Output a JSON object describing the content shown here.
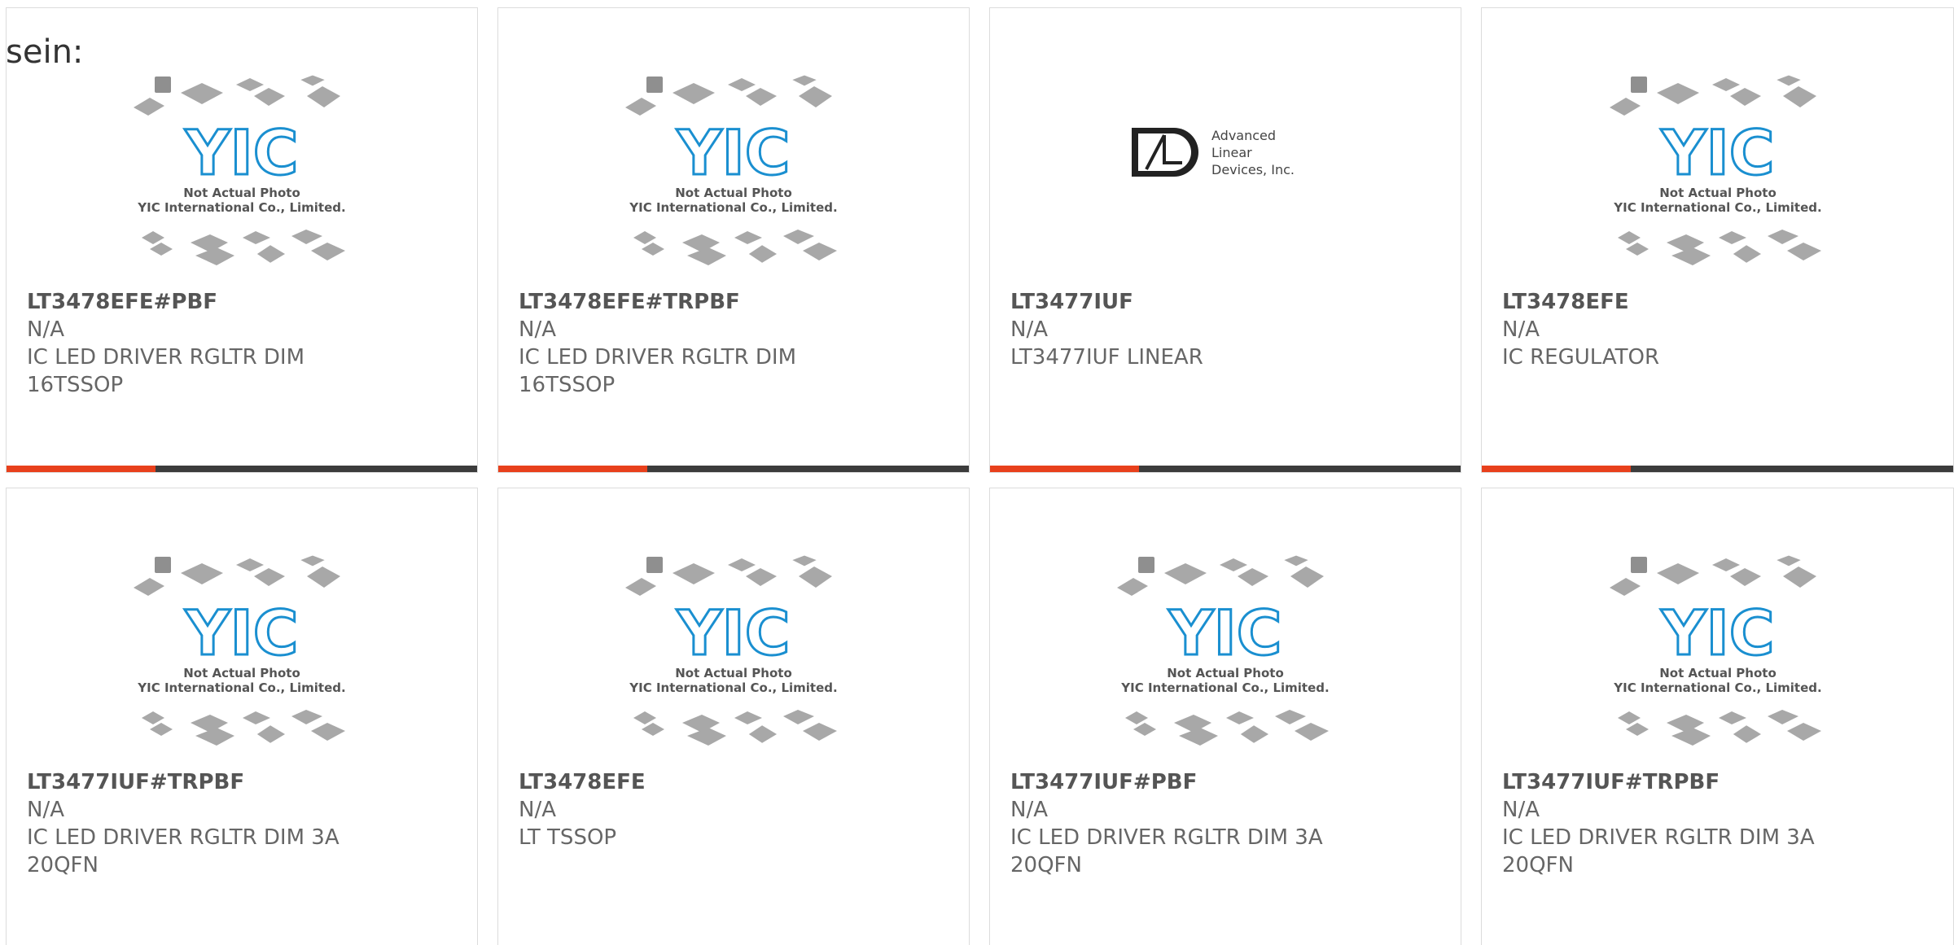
{
  "heading": "sein:",
  "placeholder_image": {
    "brand": "YIC",
    "caption_line1": "Not Actual Photo",
    "caption_line2": "YIC International Co., Limited.",
    "icon": "chip-packages-placeholder"
  },
  "ald_logo": {
    "line1": "Advanced",
    "line2": "Linear",
    "line3": "Devices, Inc.",
    "icon": "ald-logo"
  },
  "colors": {
    "accent": "#e8401c",
    "bar": "#3c3c3c",
    "yic_blue": "#1a8fd0"
  },
  "products": [
    {
      "part": "LT3478EFE#PBF",
      "mfr": "N/A",
      "desc": "IC LED DRIVER RGLTR DIM 16TSSOP",
      "image": "placeholder"
    },
    {
      "part": "LT3478EFE#TRPBF",
      "mfr": "N/A",
      "desc": "IC LED DRIVER RGLTR DIM 16TSSOP",
      "image": "placeholder"
    },
    {
      "part": "LT3477IUF",
      "mfr": "N/A",
      "desc": "LT3477IUF LINEAR",
      "image": "ald"
    },
    {
      "part": "LT3478EFE",
      "mfr": "N/A",
      "desc": "IC REGULATOR",
      "image": "placeholder"
    },
    {
      "part": "LT3477IUF#TRPBF",
      "mfr": "N/A",
      "desc": "IC LED DRIVER RGLTR DIM 3A 20QFN",
      "image": "placeholder"
    },
    {
      "part": "LT3478EFE",
      "mfr": "N/A",
      "desc": "LT TSSOP",
      "image": "placeholder"
    },
    {
      "part": "LT3477IUF#PBF",
      "mfr": "N/A",
      "desc": "IC LED DRIVER RGLTR DIM 3A 20QFN",
      "image": "placeholder"
    },
    {
      "part": "LT3477IUF#TRPBF",
      "mfr": "N/A",
      "desc": "IC LED DRIVER RGLTR DIM 3A 20QFN",
      "image": "placeholder"
    }
  ]
}
